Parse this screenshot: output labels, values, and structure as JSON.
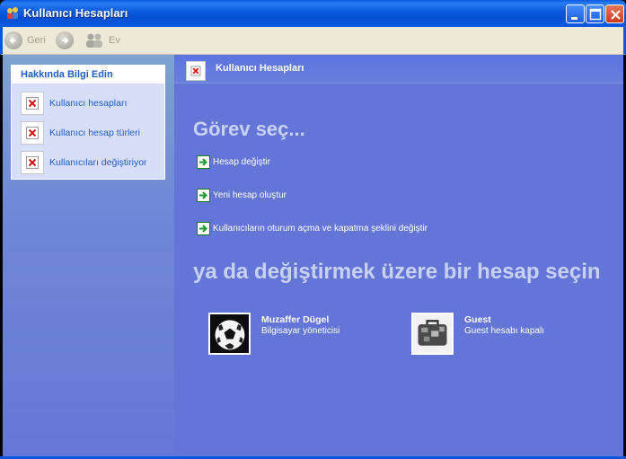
{
  "window": {
    "title": "Kullanıcı Hesapları"
  },
  "toolbar": {
    "back_label": "Geri",
    "home_label": "Ev"
  },
  "sidebar": {
    "title": "Hakkında Bilgi Edin",
    "items": [
      {
        "label": "Kullanıcı hesapları",
        "icon": "broken-image-icon"
      },
      {
        "label": "Kullanıcı hesap türleri",
        "icon": "broken-image-icon"
      },
      {
        "label": "Kullanıcıları değiştiriyor",
        "icon": "broken-image-icon"
      }
    ]
  },
  "header": {
    "title": "Kullanıcı Hesapları"
  },
  "tasks": {
    "heading": "Görev seç...",
    "items": [
      {
        "label": "Hesap değiştir"
      },
      {
        "label": "Yeni hesap oluştur"
      },
      {
        "label": "Kullanıcıların oturum açma ve kapatma şeklini değiştir"
      }
    ]
  },
  "accounts": {
    "heading": "ya da değiştirmek üzere bir hesap seçin",
    "items": [
      {
        "name": "Muzaffer Dügel",
        "description": "Bilgisayar yöneticisi",
        "picture": "soccer-ball"
      },
      {
        "name": "Guest",
        "description": "Guest hesabı kapalı",
        "picture": "suitcase"
      }
    ]
  },
  "colors": {
    "title_bar": "#0a58dc",
    "task_pane": "#6375d6",
    "link_blue": "#215dc6"
  }
}
